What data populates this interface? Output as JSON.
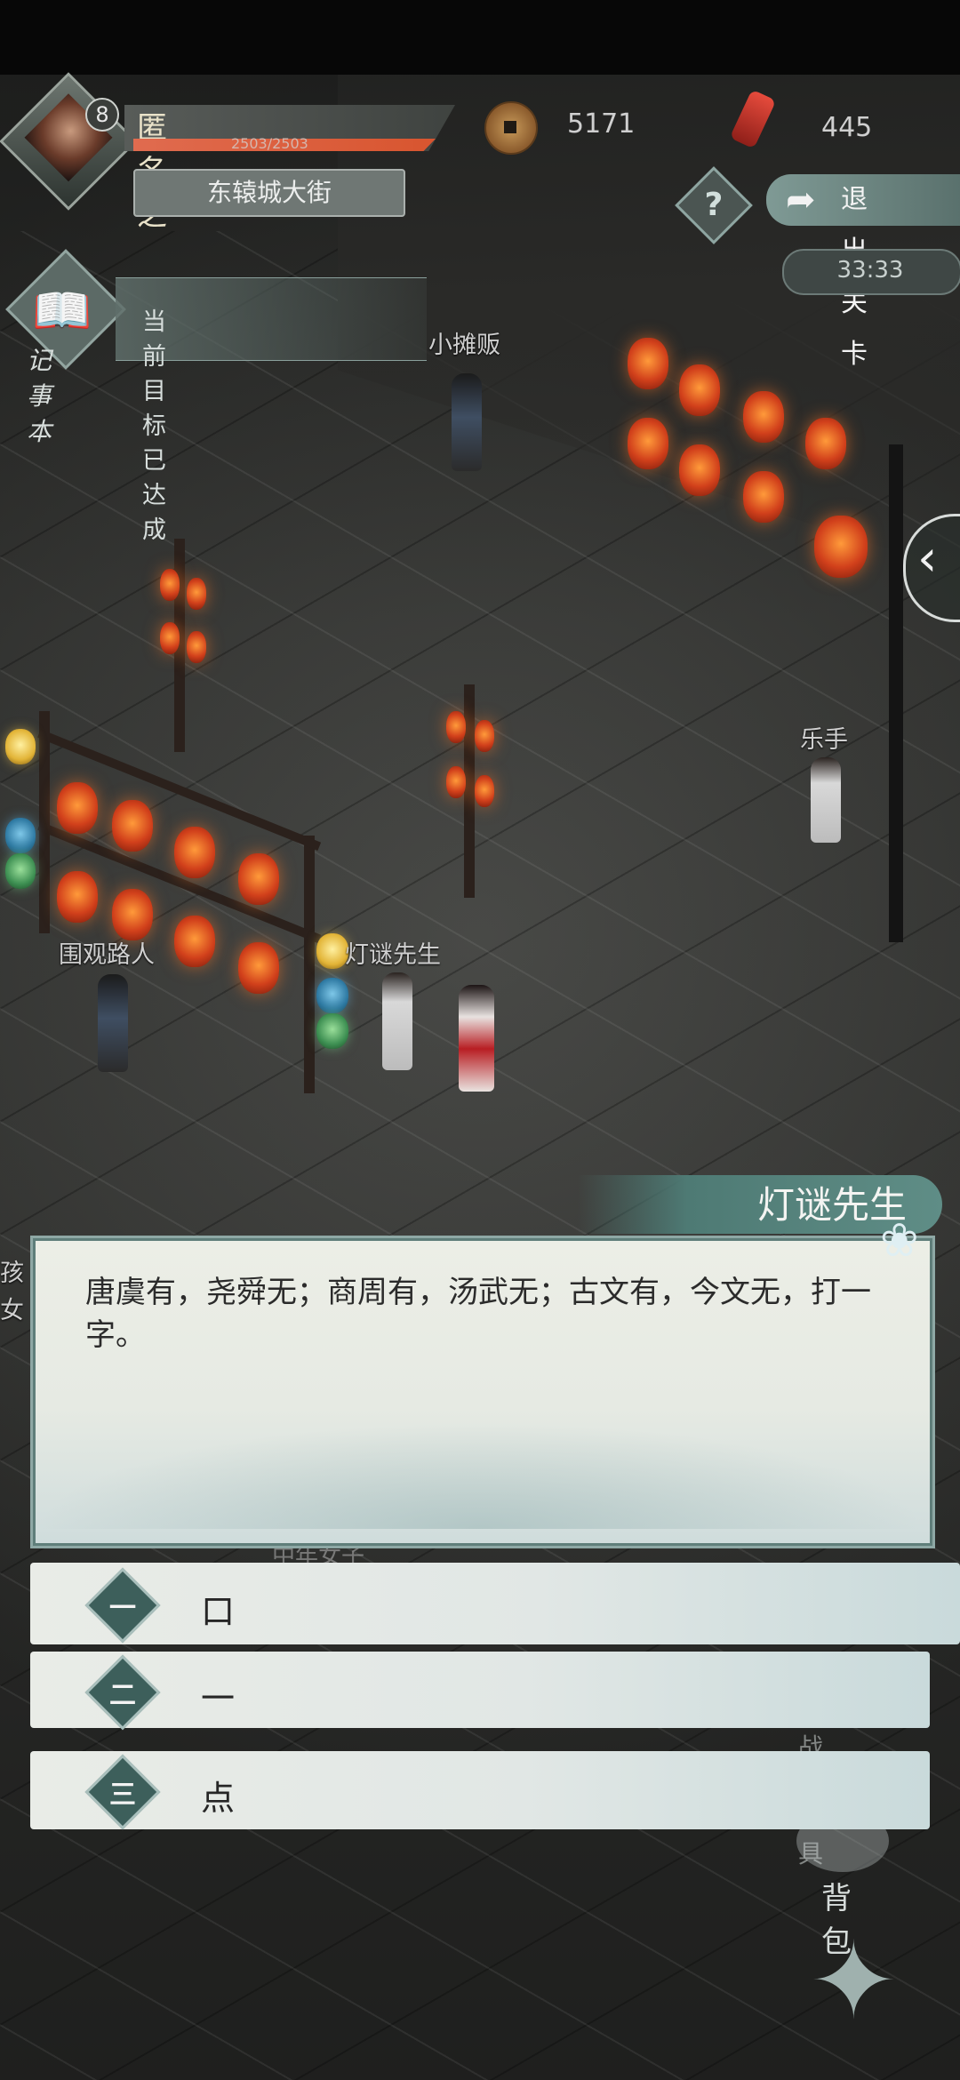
{
  "hud": {
    "level": "8",
    "player_name": "匿名之",
    "hp_text": "2503/2503",
    "hp_fraction": 1.0,
    "location": "东辕城大街",
    "coins": "5171",
    "tokens": "445",
    "help_glyph": "?",
    "exit_label": "退出关卡",
    "timer": "33:33",
    "journal_label": "记事本",
    "objective": "当前目标已达成"
  },
  "npcs": {
    "vendor": "小摊贩",
    "musician": "乐手",
    "onlooker": "围观路人",
    "riddle_master": "灯谜先生",
    "child_fragment": "孩",
    "woman_fragment": "女",
    "mid_age_woman_hidden": "中年女子"
  },
  "dialog": {
    "speaker": "灯谜先生",
    "text": "唐虞有，尧舜无；商周有，汤武无；古文有，今文无，打一字。"
  },
  "options": [
    {
      "num": "一",
      "text": "口"
    },
    {
      "num": "二",
      "text": "一"
    },
    {
      "num": "三",
      "text": "点"
    }
  ],
  "side_menu": {
    "battle_items": "战斗道具",
    "bag": "背包"
  },
  "icons": {
    "coin": "copper-coin-icon",
    "token": "red-token-icon",
    "book": "open-book-icon",
    "lotus": "lotus-icon",
    "exit_arrow": "curved-arrow-icon",
    "menu": "compass-star-icon"
  }
}
